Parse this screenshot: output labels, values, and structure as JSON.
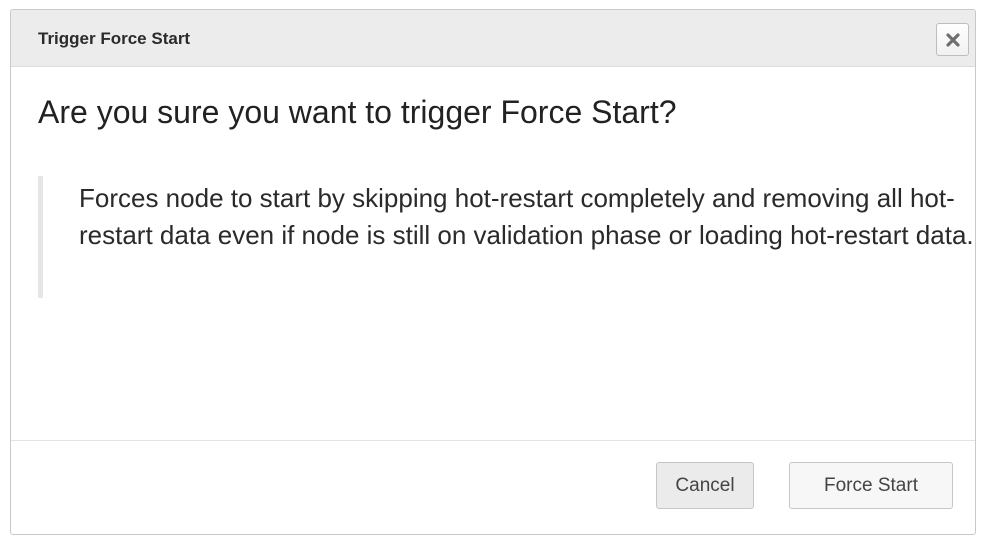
{
  "dialog": {
    "title": "Trigger Force Start",
    "close_icon": "close-icon",
    "question": "Are you sure you want to trigger Force Start?",
    "description": "Forces node to start by skipping hot-restart completely and removing all hot-restart data even if node is still on validation phase or loading hot-restart data.",
    "buttons": {
      "cancel_label": "Cancel",
      "confirm_label": "Force Start"
    }
  },
  "colors": {
    "header_background": "#ececec",
    "quote_border": "#e6e6e6",
    "cancel_background": "#ebebeb",
    "confirm_background": "#f7f7f7"
  }
}
